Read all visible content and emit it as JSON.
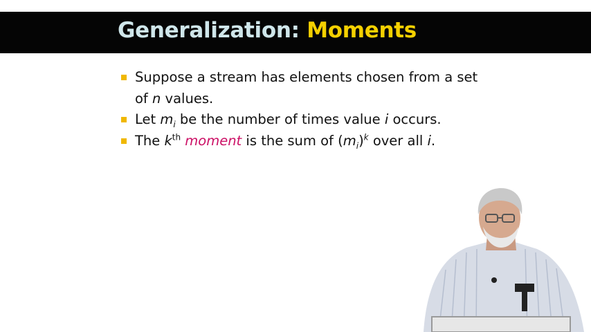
{
  "title": {
    "main": "Generalization: ",
    "accent": "Moments"
  },
  "bullets": [
    {
      "part1": "Suppose a stream has elements chosen from a set of ",
      "var_n": "n",
      "part2": " values."
    },
    {
      "part1": "Let ",
      "var_m": "m",
      "sub_i": "i",
      "part2": " be the number of times value ",
      "var_i": "i",
      "part3": " occurs."
    },
    {
      "part1": "The ",
      "var_k": "k",
      "sup_th": "th",
      "space": " ",
      "emph": "moment",
      "part2": " is the sum of (",
      "var_m": "m",
      "sub_i": "i",
      "paren_close": ")",
      "sup_k": "k",
      "part3": " over all ",
      "var_i": "i",
      "part4": "."
    }
  ],
  "colors": {
    "title_bar": "#050505",
    "title_main": "#cfe6ea",
    "title_accent": "#f5d000",
    "bullet_marker": "#f0b800",
    "emphasis": "#cc1166"
  }
}
